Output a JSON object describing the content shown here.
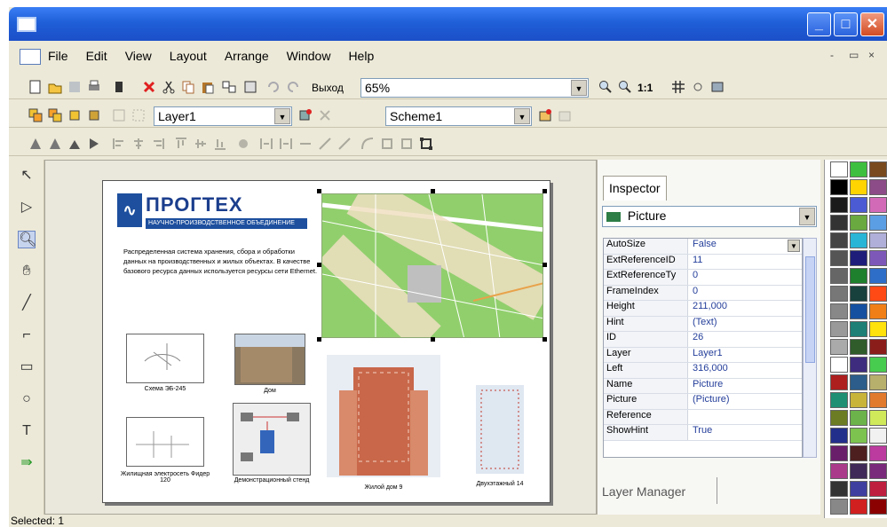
{
  "window": {
    "min_glyph": "_",
    "max_glyph": "□",
    "close_glyph": "✕"
  },
  "menu": {
    "items": [
      "File",
      "Edit",
      "View",
      "Layout",
      "Arrange",
      "Window",
      "Help"
    ],
    "mdi_min": "-",
    "mdi_restore": "▭",
    "mdi_close": "×"
  },
  "toolbar": {
    "exit_label": "Выход",
    "zoom_value": "65%",
    "layer_value": "Layer1",
    "scheme_value": "Scheme1",
    "ratio_label": "1:1"
  },
  "page_content": {
    "logo_text": "ПРОГТЕХ",
    "logo_sub": "НАУЧНО-ПРОИЗВОДСТВЕННОЕ ОБЪЕДИНЕНИЕ",
    "description": "Распределенная система хранения, сбора и обработки данных на производственных и жилых объектах. В качестве базового ресурса данных используется ресурсы сети Ethernet.",
    "captions": [
      "Схема ЭБ-245",
      "Дом",
      "Жилищная электросеть Фидер 120",
      "Демонстрационный стенд",
      "Жилой дом 9",
      "Двухэтажный 14"
    ]
  },
  "inspector": {
    "tab_label": "Inspector",
    "object_type": "Picture",
    "properties": [
      {
        "key": "AutoSize",
        "value": "False"
      },
      {
        "key": "ExtReferenceID",
        "value": "11"
      },
      {
        "key": "ExtReferenceTy",
        "value": "0"
      },
      {
        "key": "FrameIndex",
        "value": "0"
      },
      {
        "key": "Height",
        "value": "211,000"
      },
      {
        "key": "Hint",
        "value": "(Text)"
      },
      {
        "key": "ID",
        "value": "26"
      },
      {
        "key": "Layer",
        "value": "Layer1"
      },
      {
        "key": "Left",
        "value": "316,000"
      },
      {
        "key": "Name",
        "value": "Picture"
      },
      {
        "key": "Picture",
        "value": "(Picture)"
      },
      {
        "key": "Reference",
        "value": ""
      },
      {
        "key": "ShowHint",
        "value": "True"
      }
    ],
    "layer_manager_label": "Layer Manager"
  },
  "palette_colors": [
    "#ffffff",
    "#3fbf3f",
    "#7a4a1f",
    "#000000",
    "#ffd400",
    "#8c4c87",
    "#1a1a1a",
    "#4a5bd4",
    "#d36ab8",
    "#333333",
    "#69a93f",
    "#5b9ee3",
    "#444444",
    "#2ab5d6",
    "#b0afd9",
    "#555555",
    "#1e1e7a",
    "#7e58b9",
    "#666666",
    "#1e7f2c",
    "#2f6ec8",
    "#777777",
    "#18403c",
    "#ff4a16",
    "#888888",
    "#1550a0",
    "#f07f17",
    "#999999",
    "#1d7f76",
    "#ffe10b",
    "#aaaaaa",
    "#2f5c2a",
    "#8a1d1a",
    "#ffffff",
    "#3e2c7f",
    "#48cc4f",
    "#ad1e1e",
    "#2c5d8b",
    "#b7af6c",
    "#1e8f73",
    "#c9b43a",
    "#e27a2e",
    "#6c7c24",
    "#6bb34a",
    "#cfe95b",
    "#222f8b",
    "#7cc44f",
    "#f1f1f1",
    "#6a1f6b",
    "#4d1f1f",
    "#bb3b9f",
    "#aa3b8b",
    "#3f2a58",
    "#7a2a7a",
    "#333333",
    "#3f3f9f",
    "#bf1f3f",
    "#888888",
    "#d02020",
    "#8b0000"
  ],
  "status": {
    "text": "Selected: 1"
  }
}
